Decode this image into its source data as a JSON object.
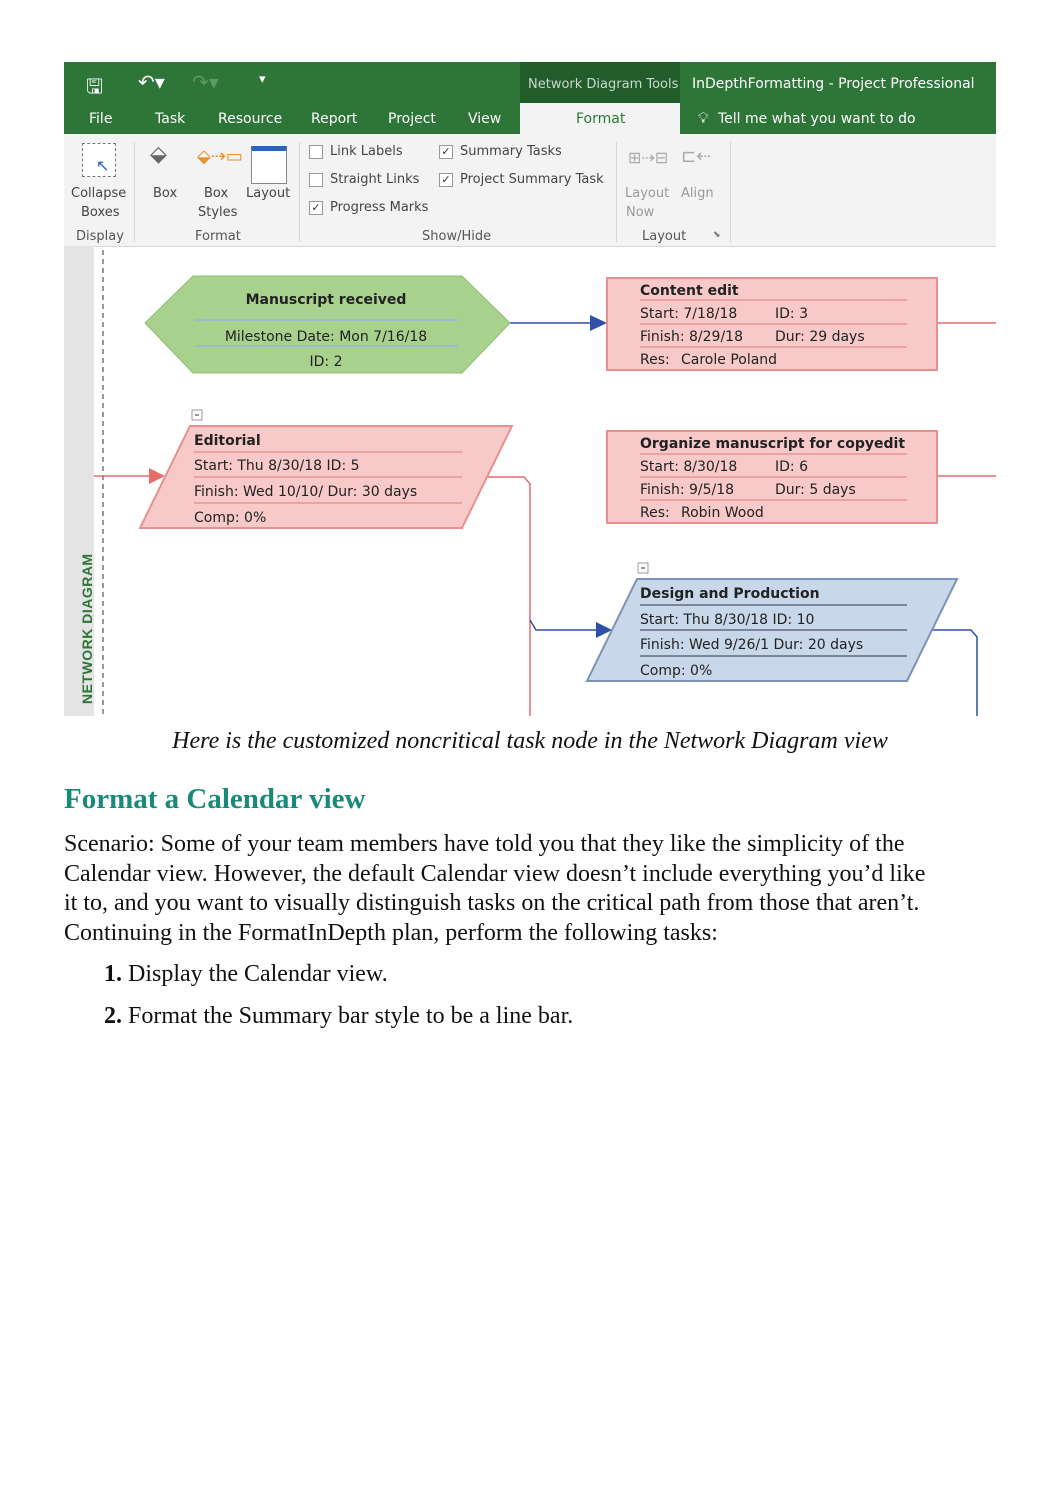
{
  "screenshot": {
    "title_bar": {
      "icons": [
        "save-icon",
        "undo-icon",
        "redo-icon",
        "customize-icon"
      ],
      "contextual_tab_group": "Network Diagram Tools",
      "window_title": "InDepthFormatting - Project Professional"
    },
    "tabs": [
      "File",
      "Task",
      "Resource",
      "Report",
      "Project",
      "View",
      "Format"
    ],
    "active_tab": "Format",
    "tell_me": "Tell me what you want to do",
    "ribbon": {
      "display": {
        "label": "Display",
        "collapse_boxes": [
          "Collapse",
          "Boxes"
        ]
      },
      "format": {
        "label": "Format",
        "box": "Box",
        "box_styles": [
          "Box",
          "Styles"
        ],
        "layout": "Layout"
      },
      "show_hide": {
        "label": "Show/Hide",
        "checkboxes": [
          {
            "label": "Link Labels",
            "checked": false
          },
          {
            "label": "Straight Links",
            "checked": false
          },
          {
            "label": "Progress Marks",
            "checked": true
          },
          {
            "label": "Summary Tasks",
            "checked": true
          },
          {
            "label": "Project Summary Task",
            "checked": true
          }
        ]
      },
      "layout": {
        "label": "Layout",
        "layout_now": [
          "Layout",
          "Now"
        ],
        "align": "Align"
      }
    },
    "side_label": "NETWORK DIAGRAM",
    "nodes": {
      "milestone": {
        "title": "Manuscript received",
        "date": "Milestone Date: Mon 7/16/18",
        "id": "ID: 2",
        "color": "#a9d18e"
      },
      "content_edit": {
        "title": "Content edit",
        "start": "Start:  7/18/18",
        "id": "ID:  3",
        "finish": "Finish: 8/29/18",
        "dur": "Dur: 29 days",
        "res": "Res:",
        "res_name": "Carole Poland",
        "color": "#f8c9c9"
      },
      "editorial": {
        "title": "Editorial",
        "start": "Start:  Thu 8/30/18 ID:   5",
        "finish": "Finish: Wed 10/10/ Dur: 30 days",
        "comp": "Comp: 0%",
        "color": "#f8c9c9"
      },
      "organize": {
        "title": "Organize manuscript for copyedit",
        "start": "Start:  8/30/18",
        "id": "ID:  6",
        "finish": "Finish: 9/5/18",
        "dur": "Dur: 5 days",
        "res": "Res:",
        "res_name": "Robin Wood",
        "color": "#f8c9c9"
      },
      "design": {
        "title": "Design and Production",
        "start": "Start:  Thu 8/30/18 ID:   10",
        "finish": "Finish: Wed 9/26/1 Dur: 20 days",
        "comp": "Comp: 0%",
        "color": "#c9d7ea"
      }
    }
  },
  "caption": "Here is the customized noncritical task node in the Network Diagram view",
  "heading": "Format a Calendar view",
  "paragraph_lines": [
    "Scenario: Some of your team members have told you that they like the simplicity of the",
    "Calendar view. However, the default Calendar view doesn’t include everything you’d like",
    "it to, and you want to visually distinguish tasks on the critical path from those that aren’t.",
    "Continuing in the FormatInDepth plan, perform the following tasks:"
  ],
  "steps": [
    {
      "num": "1.",
      "text": "Display the Calendar view."
    },
    {
      "num": "2.",
      "text": "Format the Summary bar style to be a line bar."
    }
  ],
  "colors": {
    "ribbon_green": "#2e7538",
    "heading": "#1a8a78",
    "critical": "#e86c6c",
    "link_blue": "#2f4fa8"
  }
}
